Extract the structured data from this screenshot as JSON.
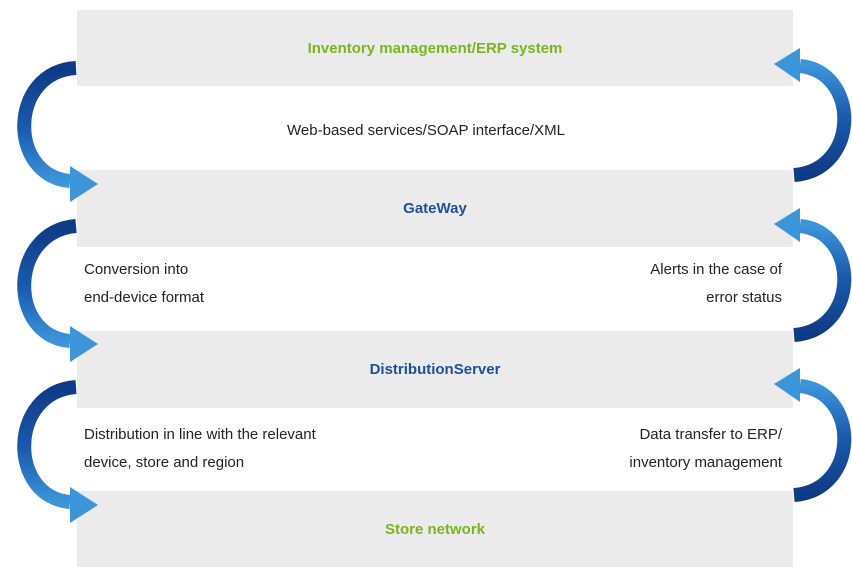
{
  "colors": {
    "band_bg": "#ebebeb",
    "green_label": "#7ab51d",
    "blue_label": "#1e4f9c",
    "arrow_dark": "#0f3a84",
    "arrow_light": "#3b95d9"
  },
  "bands": {
    "erp": "Inventory management/ERP system",
    "gateway": "GateWay",
    "distribution": "DistributionServer",
    "store": "Store network"
  },
  "connectors": {
    "erp_gateway": "Web-based services/SOAP interface/XML",
    "gateway_left": [
      "Conversion into",
      "end-device format"
    ],
    "gateway_right": [
      "Alerts in the case of",
      "error status"
    ],
    "distribution_left": [
      "Distribution in line with the relevant",
      "device, store and region"
    ],
    "distribution_right": [
      "Data transfer to ERP/",
      "inventory management"
    ]
  },
  "icons": {
    "left_arrows": "curved-down-arrow-icon",
    "right_arrows": "curved-up-arrow-icon"
  }
}
